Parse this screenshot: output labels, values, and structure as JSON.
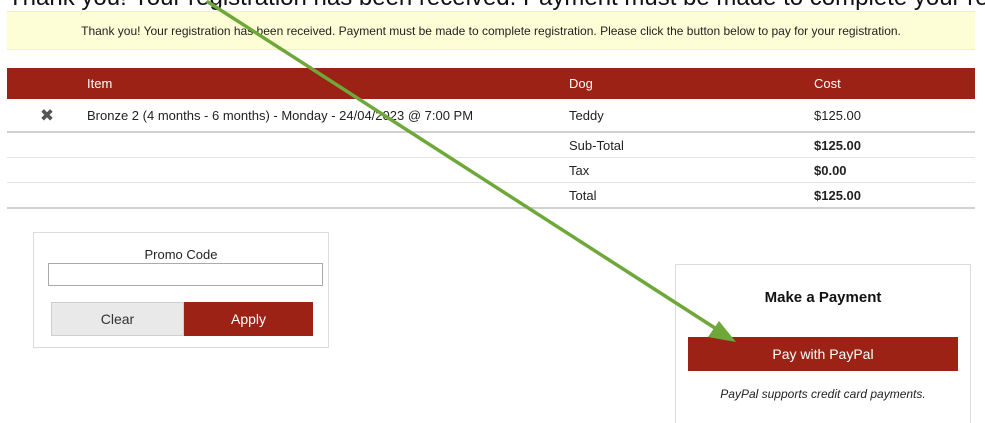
{
  "top_strip_text": "Thank you! Your registration has been received. Payment must be made to complete your registration. Please",
  "notice": "Thank you! Your registration has been received. Payment must be made to complete registration. Please click the button below to pay for your registration.",
  "cart": {
    "headers": {
      "item": "Item",
      "dog": "Dog",
      "cost": "Cost"
    },
    "rows": [
      {
        "remove_icon": "✖",
        "item": "Bronze 2 (4 months - 6 months) - Monday - 24/04/2023 @ 7:00 PM",
        "dog": "Teddy",
        "cost": "$125.00"
      }
    ],
    "summary": [
      {
        "label": "Sub-Total",
        "value": "$125.00"
      },
      {
        "label": "Tax",
        "value": "$0.00"
      },
      {
        "label": "Total",
        "value": "$125.00"
      }
    ]
  },
  "promo": {
    "label": "Promo Code",
    "value": "",
    "placeholder": "",
    "clear_label": "Clear",
    "apply_label": "Apply"
  },
  "payment": {
    "title": "Make a Payment",
    "paypal_label": "Pay with PayPal",
    "note": "PayPal supports credit card payments."
  },
  "colors": {
    "brand": "#9b2214",
    "notice_bg": "#fdfdd6",
    "annotation_arrow": "#6fa83a"
  }
}
